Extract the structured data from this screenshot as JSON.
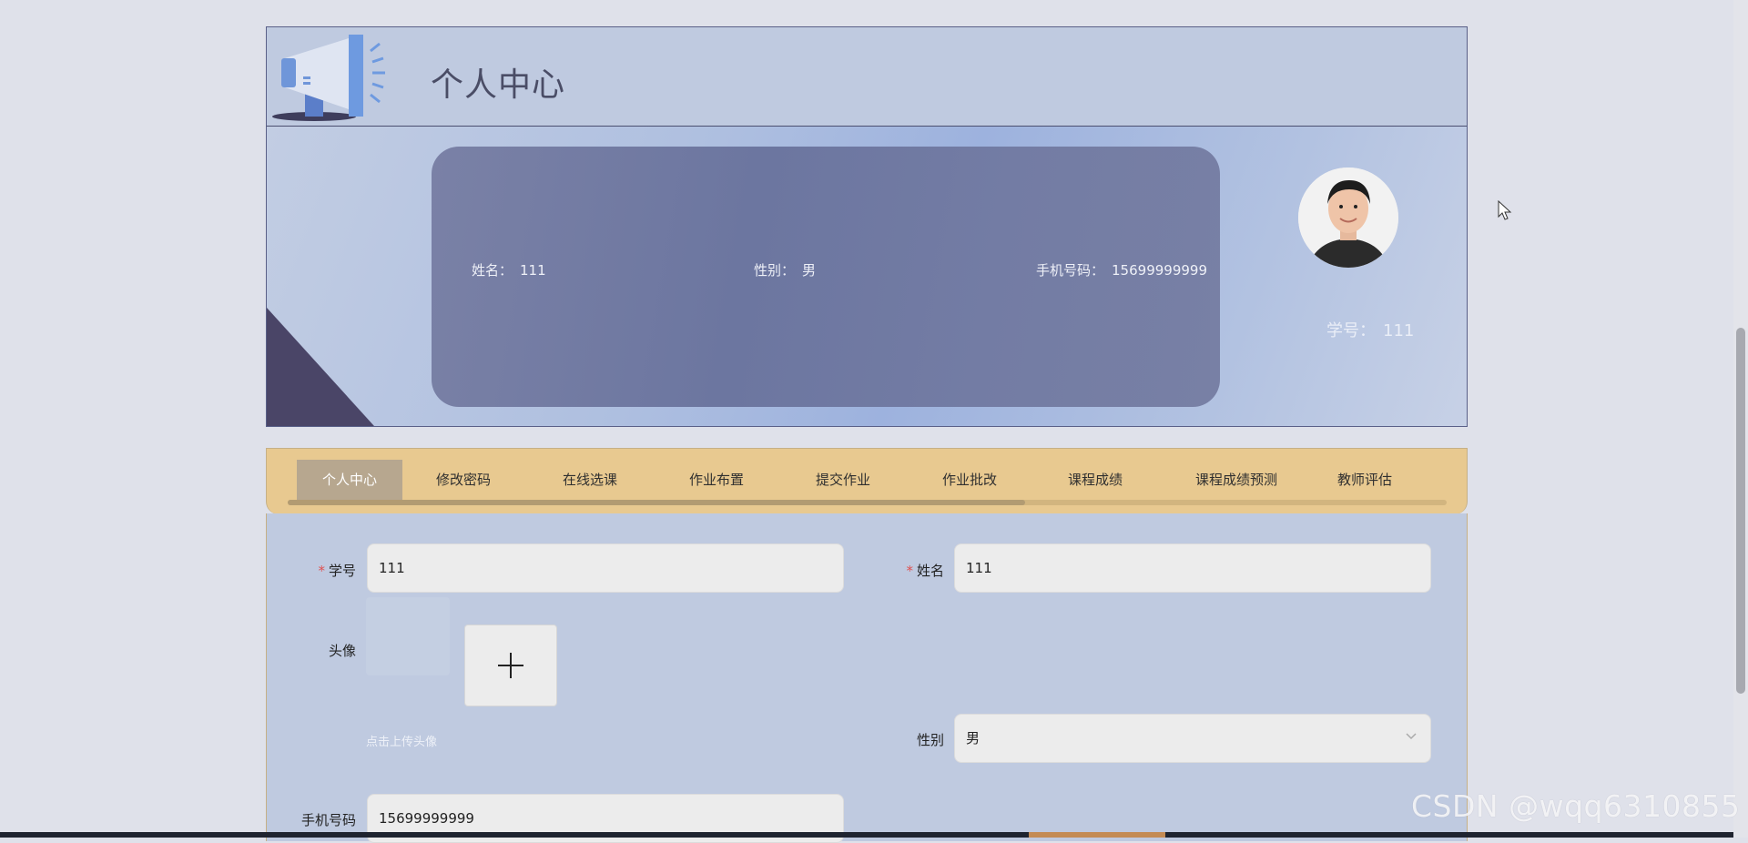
{
  "header": {
    "title": "个人中心"
  },
  "profile": {
    "name_label": "姓名：",
    "name_value": "111",
    "gender_label": "性别：",
    "gender_value": "男",
    "phone_label": "手机号码：",
    "phone_value": "15699999999",
    "student_id_label": "学号：",
    "student_id_value": "111"
  },
  "tabs": [
    {
      "label": "个人中心",
      "active": true
    },
    {
      "label": "修改密码"
    },
    {
      "label": "在线选课"
    },
    {
      "label": "作业布置"
    },
    {
      "label": "提交作业"
    },
    {
      "label": "作业批改"
    },
    {
      "label": "课程成绩"
    },
    {
      "label": "课程成绩预测"
    },
    {
      "label": "教师评估"
    }
  ],
  "form": {
    "student_id_label": "学号",
    "student_id_value": "111",
    "name_label": "姓名",
    "name_value": "111",
    "avatar_label": "头像",
    "avatar_hint": "点击上传头像",
    "gender_label": "性别",
    "gender_value": "男",
    "phone_label": "手机号码",
    "phone_value": "15699999999"
  },
  "watermark": "CSDN @wqq6310855",
  "colors": {
    "header_bg": "#bfcae0",
    "tabs_bg": "#e8c990",
    "tab_active_bg": "#b7a78f",
    "info_box": "#737ca4"
  }
}
